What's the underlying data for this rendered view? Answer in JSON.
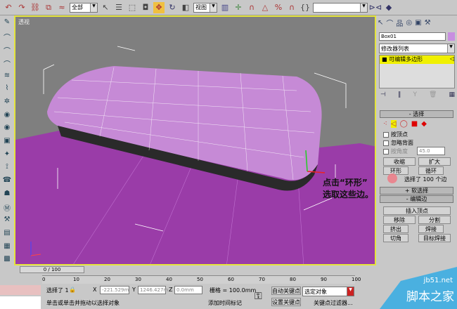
{
  "toolbar": {
    "filter_select": "全部",
    "coord_select": "视图",
    "named_selection": ""
  },
  "viewport": {
    "label": "透视",
    "annotation_line1": "点击“环形”",
    "annotation_line2": "选取这些边。"
  },
  "panel": {
    "object_name": "Box01",
    "object_color": "#c88ee0",
    "modifier_list": "修改器列表",
    "stack_item": "可编辑多边形",
    "selection": {
      "title": "选择",
      "by_vertex": "按顶点",
      "ignore_backfacing": "忽略背面",
      "by_angle": "按角度",
      "angle_value": "45.0",
      "shrink": "收缩",
      "grow": "扩大",
      "ring": "环形",
      "loop": "循环",
      "status": "选择了 100 个边"
    },
    "soft_selection": {
      "title": "软选择",
      "sign": "+"
    },
    "edit_edges": {
      "title": "编辑边",
      "sign": "-",
      "insert_vertex": "插入顶点",
      "remove": "移除",
      "split": "分割",
      "extrude": "挤出",
      "weld": "焊接",
      "chamfer": "切角",
      "target_weld": "目标焊接"
    }
  },
  "timeline": {
    "frame": "0 / 100",
    "ticks": [
      "0",
      "10",
      "20",
      "30",
      "40",
      "50",
      "60",
      "70",
      "80",
      "90",
      "100"
    ]
  },
  "status": {
    "selected": "选择了 1",
    "x_label": "X",
    "x": "-221.529m",
    "y_label": "Y",
    "y": "1246.427m",
    "z_label": "Z",
    "z": "0.0mm",
    "grid": "栅格 = 100.0mm",
    "prompt": "单击或单击并拖动以选择对象",
    "add_time_tag": "添加时间标记",
    "auto_key": "自动关键点",
    "set_key": "设置关键点",
    "key_mode_select": "选定对象",
    "key_filters": "关键点过滤器..."
  },
  "watermark": {
    "site": "jb51.net",
    "name": "脚本之家"
  }
}
